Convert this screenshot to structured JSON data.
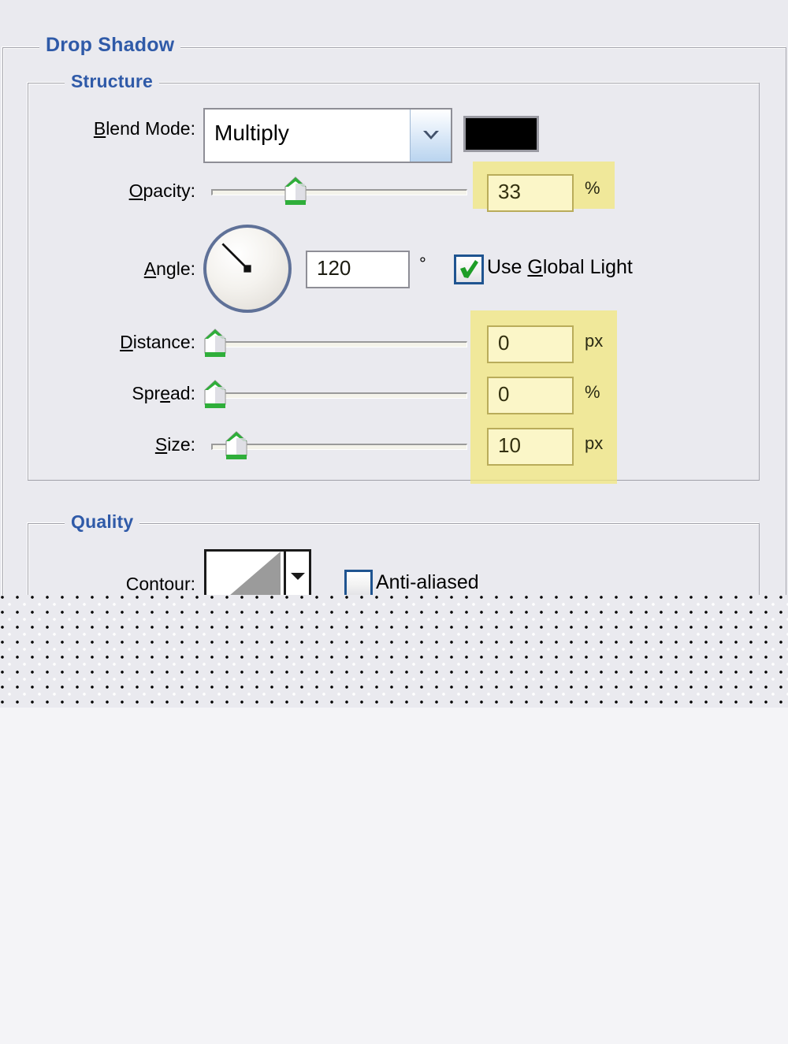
{
  "dialog": {
    "sections": {
      "drop_shadow": {
        "title": "Drop Shadow"
      },
      "structure": {
        "title": "Structure"
      },
      "quality": {
        "title": "Quality"
      }
    },
    "fields": {
      "blend_mode": {
        "label": "Blend Mode:",
        "label_pre": "B",
        "label_post": "lend Mode:",
        "value": "Multiply",
        "color_swatch": "#000000",
        "arrow_icon": "chevron-down-icon"
      },
      "opacity": {
        "label_pre": "O",
        "label_post": "pacity:",
        "value": "33",
        "unit": "%",
        "slider_percent": 33
      },
      "angle": {
        "label_pre": "A",
        "label_post": "ngle:",
        "value": "120",
        "unit": "°",
        "dial_degrees": 120
      },
      "use_global_light": {
        "label_pre": "Use ",
        "label_mid": "G",
        "label_post": "lobal Light",
        "checked": true
      },
      "distance": {
        "label_pre": "D",
        "label_post": "istance:",
        "value": "0",
        "unit": "px",
        "slider_percent": 0
      },
      "spread": {
        "label_pre": "Spr",
        "label_mid": "e",
        "label_post": "ad:",
        "value": "0",
        "unit": "%",
        "slider_percent": 0
      },
      "size": {
        "label_pre": "S",
        "label_post": "ize:",
        "value": "10",
        "unit": "px",
        "slider_percent": 5
      },
      "contour": {
        "label": "Contour:",
        "arrow_icon": "triangle-down-icon"
      },
      "anti_aliased": {
        "label": "Anti-aliased",
        "checked": false
      }
    },
    "colors": {
      "dialog_background": "#eaeaef",
      "group_title": "#2f5aa8",
      "highlight_yellow": "#f3e779",
      "accent_blue": "#1f5490",
      "check_green": "#1e9e27",
      "swatch": "#000000"
    }
  }
}
